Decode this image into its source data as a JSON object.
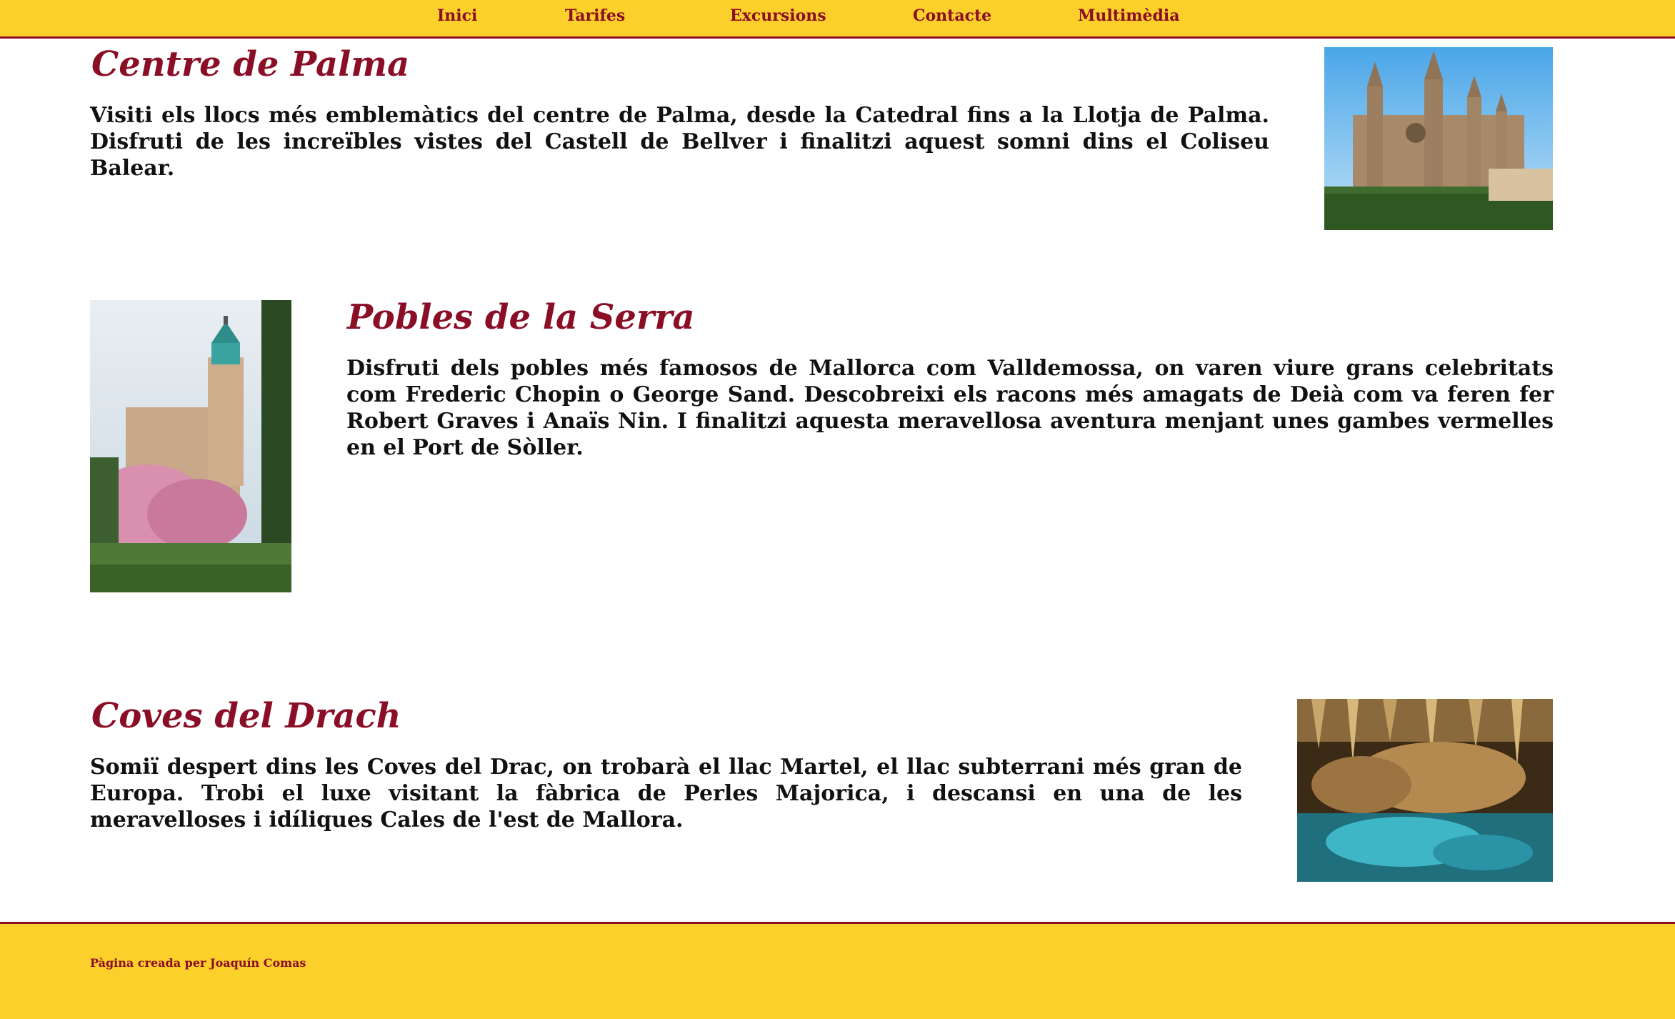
{
  "nav": {
    "items": [
      {
        "label": "Inici"
      },
      {
        "label": "Tarifes"
      },
      {
        "label": "Excursions"
      },
      {
        "label": "Contacte"
      },
      {
        "label": "Multimèdia"
      }
    ]
  },
  "sections": [
    {
      "title": "Centre de Palma",
      "text": "Visiti els llocs més emblemàtics del centre de Palma, desde la Catedral fins a la Llotja de Palma. Disfruti de les increïbles vistes del Castell de Bellver i finalitzi aquest somni dins el Coliseu Balear."
    },
    {
      "title": "Pobles de la Serra",
      "text": "Disfruti dels pobles més famosos de Mallorca com Valldemossa, on varen viure grans celebritats com Frederic Chopin o George Sand. Descobreixi els racons més amagats de Deià com va feren fer Robert Graves i Anaïs Nin. I finalitzi aquesta meravellosa aventura menjant unes gambes vermelles en el Port de Sòller."
    },
    {
      "title": "Coves del Drach",
      "text": "Somiï despert dins les Coves del Drac, on trobarà el llac Martel, el llac subterrani més gran de Europa. Trobi el luxe visitant la fàbrica de Perles Majorica, i descansi en una de les meravelloses i idíliques Cales de l'est de Mallora."
    }
  ],
  "footer": {
    "text": "Pàgina creada per Joaquín Comas"
  },
  "colors": {
    "accent": "#8a0e26",
    "bar_background": "#fcd02b",
    "text": "#111111"
  }
}
